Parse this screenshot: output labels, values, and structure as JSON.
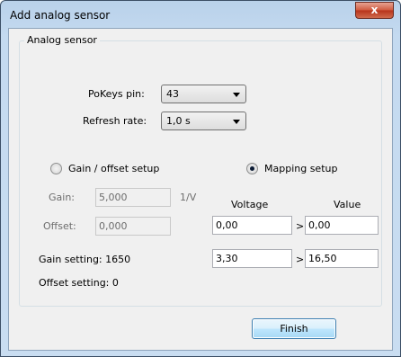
{
  "window": {
    "title": "Add analog sensor",
    "close_glyph": "x"
  },
  "group": {
    "label": "Analog sensor"
  },
  "pokeys_pin": {
    "label": "PoKeys pin:",
    "value": "43"
  },
  "refresh_rate": {
    "label": "Refresh rate:",
    "value": "1,0 s"
  },
  "modes": {
    "gain_offset": {
      "label": "Gain / offset setup",
      "selected": false
    },
    "mapping": {
      "label": "Mapping setup",
      "selected": true
    }
  },
  "gain": {
    "label": "Gain:",
    "value": "5,000",
    "unit": "1/V"
  },
  "offset": {
    "label": "Offset:",
    "value": "0,000"
  },
  "gain_setting": "Gain setting: 1650",
  "offset_setting": "Offset setting: 0",
  "mapping": {
    "voltage_header": "Voltage",
    "value_header": "Value",
    "arrow": ">",
    "rows": [
      {
        "voltage": "0,00",
        "value": "0,00"
      },
      {
        "voltage": "3,30",
        "value": "16,50"
      }
    ]
  },
  "buttons": {
    "finish": "Finish"
  }
}
